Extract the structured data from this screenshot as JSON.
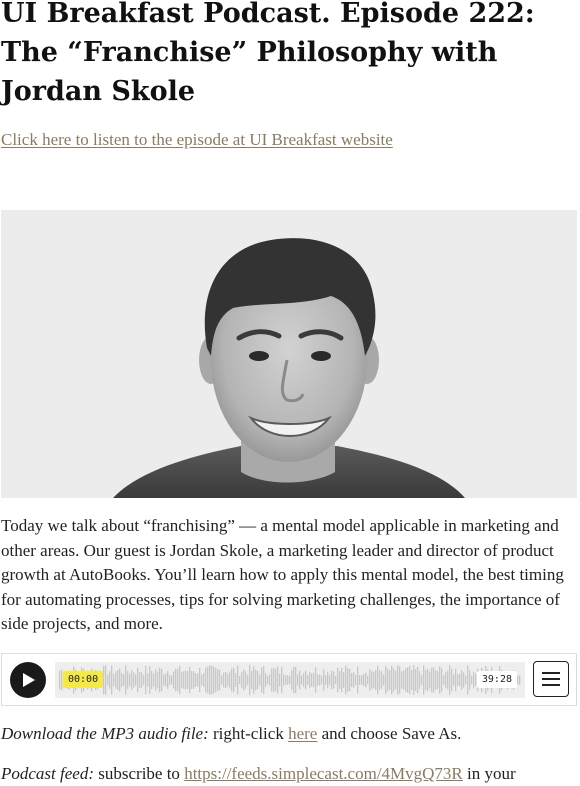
{
  "article": {
    "title": "UI Breakfast Podcast. Episode 222: The “Franchise” Philosophy with Jordan Skole",
    "listen_link": "Click here to listen to the episode at UI Breakfast website",
    "intro": "Today we talk about “franchising” — a mental model applicable in marketing and other areas. Our guest is Jordan Skole, a marketing leader and director of product growth at AutoBooks. You’ll learn how to apply this mental model, the best timing for automating processes, tips for solving marketing challenges, the importance of side projects, and more."
  },
  "player": {
    "current_time": "00:00",
    "duration": "39:28",
    "play_icon": "play-icon",
    "menu_icon": "hamburger-menu-icon"
  },
  "download": {
    "label": "Download the MP3 audio file:",
    "before_link": " right-click ",
    "link": "here",
    "after_link": " and choose Save As."
  },
  "feed": {
    "label": "Podcast feed:",
    "before_link": " subscribe to ",
    "link": "https://feeds.simplecast.com/4MvgQ73R",
    "after_link": " in your"
  },
  "colors": {
    "link": "#8a7b62",
    "time_highlight": "#f5e94a",
    "waveform": "#c8c8c8",
    "photo_bg": "#ececec"
  }
}
